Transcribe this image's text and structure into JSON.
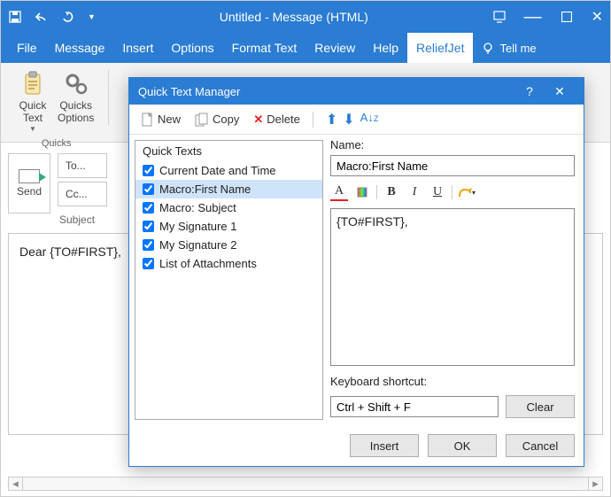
{
  "window": {
    "title": "Untitled  -  Message (HTML)"
  },
  "menu": {
    "file": "File",
    "message": "Message",
    "insert": "Insert",
    "options": "Options",
    "format": "Format Text",
    "review": "Review",
    "help": "Help",
    "reliefjet": "ReliefJet",
    "tellme": "Tell me"
  },
  "ribbon": {
    "quick_text": "Quick\nText",
    "quicks_options": "Quicks\nOptions",
    "group_label": "Quicks"
  },
  "compose": {
    "send": "Send",
    "to": "To...",
    "cc": "Cc...",
    "subject": "Subject",
    "body": "Dear {TO#FIRST},"
  },
  "dialog": {
    "title": "Quick Text Manager",
    "toolbar": {
      "new": "New",
      "copy": "Copy",
      "delete": "Delete"
    },
    "list_header": "Quick Texts",
    "items": [
      {
        "label": "Current Date and Time",
        "checked": true
      },
      {
        "label": "Macro:First Name",
        "checked": true,
        "selected": true
      },
      {
        "label": "Macro: Subject",
        "checked": true
      },
      {
        "label": "My Signature 1",
        "checked": true
      },
      {
        "label": "My Signature 2",
        "checked": true
      },
      {
        "label": "List of Attachments",
        "checked": true
      }
    ],
    "name_label": "Name:",
    "name_value": "Macro:First Name",
    "content_value": "{TO#FIRST},",
    "shortcut_label": "Keyboard shortcut:",
    "shortcut_value": "Ctrl + Shift + F",
    "clear": "Clear",
    "insert": "Insert",
    "ok": "OK",
    "cancel": "Cancel"
  }
}
